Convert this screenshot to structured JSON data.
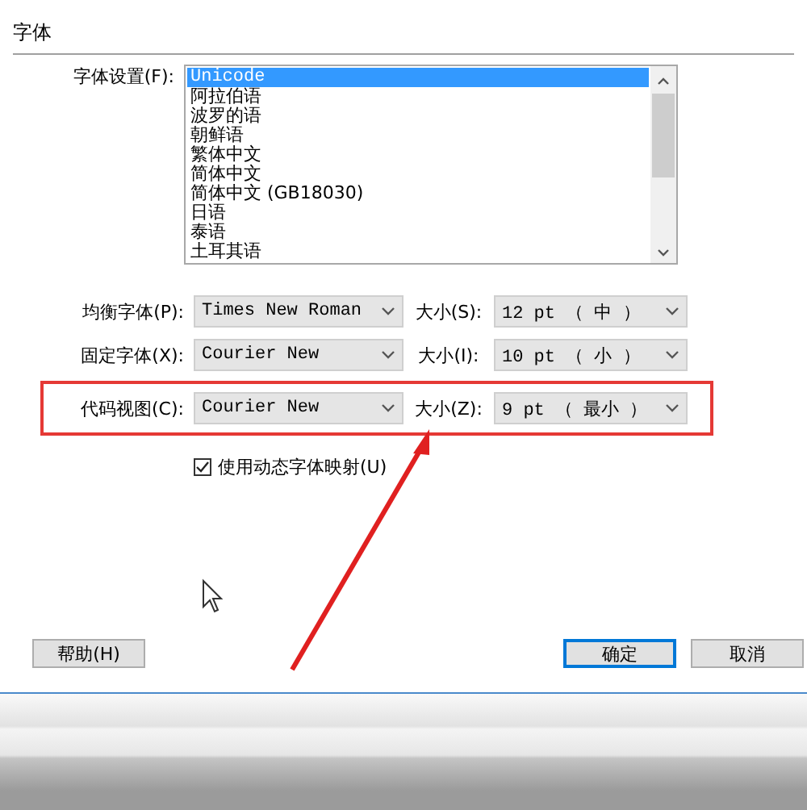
{
  "section_title": "字体",
  "font_settings": {
    "label": "字体设置(F):",
    "options": [
      {
        "text": "Unicode",
        "selected": true
      },
      {
        "text": "阿拉伯语",
        "selected": false
      },
      {
        "text": "波罗的语",
        "selected": false
      },
      {
        "text": "朝鲜语",
        "selected": false
      },
      {
        "text": "繁体中文",
        "selected": false
      },
      {
        "text": "简体中文",
        "selected": false
      },
      {
        "text": "简体中文 (GB18030)",
        "selected": false
      },
      {
        "text": "日语",
        "selected": false
      },
      {
        "text": "泰语",
        "selected": false
      },
      {
        "text": "土耳其语",
        "selected": false
      }
    ]
  },
  "font_rows": [
    {
      "label": "均衡字体(P):",
      "font": "Times New Roman",
      "size_label": "大小(S):",
      "size": "12 pt （ 中 ）",
      "highlighted": false
    },
    {
      "label": "固定字体(X):",
      "font": "Courier New",
      "size_label": "大小(I):",
      "size": "10 pt （ 小 ）",
      "highlighted": false
    },
    {
      "label": "代码视图(C):",
      "font": "Courier New",
      "size_label": "大小(Z):",
      "size": "9 pt   （ 最小 ）",
      "highlighted": true
    }
  ],
  "dynamic_mapping": {
    "label": "使用动态字体映射(U)",
    "checked": true
  },
  "buttons": [
    {
      "label": "帮助(H)",
      "default": false
    },
    {
      "label": "确定",
      "default": true
    },
    {
      "label": "取消",
      "default": false
    }
  ]
}
